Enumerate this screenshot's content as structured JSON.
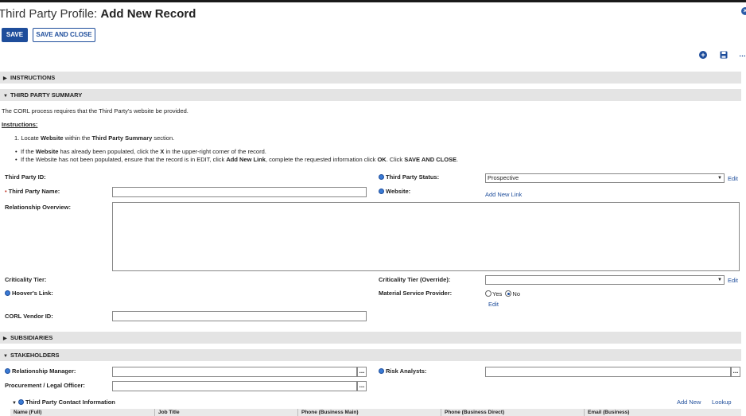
{
  "page": {
    "title_prefix": "Third Party Profile: ",
    "title_main": "Add New Record"
  },
  "toolbar": {
    "save_label": "SAVE",
    "save_close_label": "SAVE AND CLOSE",
    "close_icon": "close-icon",
    "add_icon": "add-icon",
    "save_icon": "floppy-disk-icon",
    "more_label": "…"
  },
  "sections": {
    "instructions": "INSTRUCTIONS",
    "summary": "THIRD PARTY SUMMARY",
    "subsidiaries": "SUBSIDIARIES",
    "stakeholders": "STAKEHOLDERS"
  },
  "summary": {
    "intro": "The CORL process requires that the Third Party's website be provided.",
    "instructions_heading": "Instructions",
    "step1_a": "1. Locate ",
    "step1_b": "Website",
    "step1_c": " within the ",
    "step1_d": "Third Party Summary",
    "step1_e": " section.",
    "b1_a": "If the ",
    "b1_b": "Website",
    "b1_c": " has already been populated, click the ",
    "b1_d": "X",
    "b1_e": " in the upper-right corner of the record.",
    "b2_a": "If the Website has not been populated, ensure that the record is in EDIT, click ",
    "b2_b": "Add New Link",
    "b2_c": ", complete the requested information click ",
    "b2_d": "OK",
    "b2_e": ". Click ",
    "b2_f": "SAVE AND CLOSE",
    "b2_g": "."
  },
  "fields": {
    "third_party_id": "Third Party ID:",
    "third_party_name": "Third Party Name:",
    "relationship_overview": "Relationship Overview:",
    "criticality_tier": "Criticality Tier:",
    "hoovers_link": "Hoover's Link:",
    "corl_vendor_id": "CORL Vendor ID:",
    "third_party_status": "Third Party Status:",
    "third_party_status_value": "Prospective",
    "website": "Website:",
    "add_new_link": "Add New Link",
    "criticality_tier_override": "Criticality Tier (Override):",
    "material_service_provider": "Material Service Provider:",
    "yes_label": "Yes",
    "no_label": "No",
    "edit_label": "Edit"
  },
  "stakeholders": {
    "relationship_manager": "Relationship Manager:",
    "procurement_officer": "Procurement / Legal Officer:",
    "risk_analysts": "Risk Analysts:",
    "lookup_button": "...",
    "contact_section": "Third Party Contact Information",
    "add_new": "Add New",
    "lookup": "Lookup",
    "columns": [
      "Name (Full)",
      "Job Title",
      "Phone (Business Main)",
      "Phone (Business Direct)",
      "Email (Business)"
    ]
  }
}
